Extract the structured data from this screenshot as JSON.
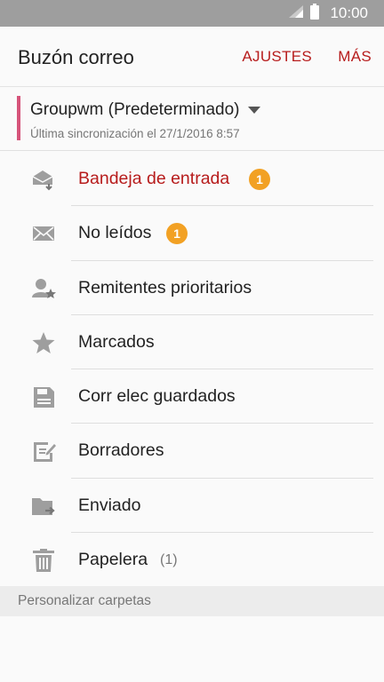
{
  "status_bar": {
    "time": "10:00",
    "signal_icon": "signal-icon",
    "battery_icon": "battery-icon"
  },
  "app_bar": {
    "title": "Buzón correo",
    "settings_label": "AJUSTES",
    "more_label": "MÁS"
  },
  "account": {
    "name": "Groupwm (Predeterminado)",
    "sync_text": "Última sincronización el 27/1/2016 8:57"
  },
  "folders": [
    {
      "label": "Bandeja de entrada",
      "badge": "1",
      "icon": "inbox-icon",
      "active": true
    },
    {
      "label": "No leídos",
      "badge": "1",
      "icon": "envelope-icon"
    },
    {
      "label": "Remitentes prioritarios",
      "icon": "priority-sender-icon"
    },
    {
      "label": "Marcados",
      "icon": "star-icon"
    },
    {
      "label": "Corr elec guardados",
      "icon": "save-icon"
    },
    {
      "label": "Borradores",
      "icon": "drafts-icon"
    },
    {
      "label": "Enviado",
      "icon": "sent-folder-icon"
    },
    {
      "label": "Papelera",
      "count": "(1)",
      "icon": "trash-icon"
    }
  ],
  "section_header": "Personalizar carpetas",
  "colors": {
    "accent": "#b71c1c",
    "badge": "#f2a124",
    "account_marker": "#d6547a",
    "status_bar": "#9e9e9e"
  }
}
